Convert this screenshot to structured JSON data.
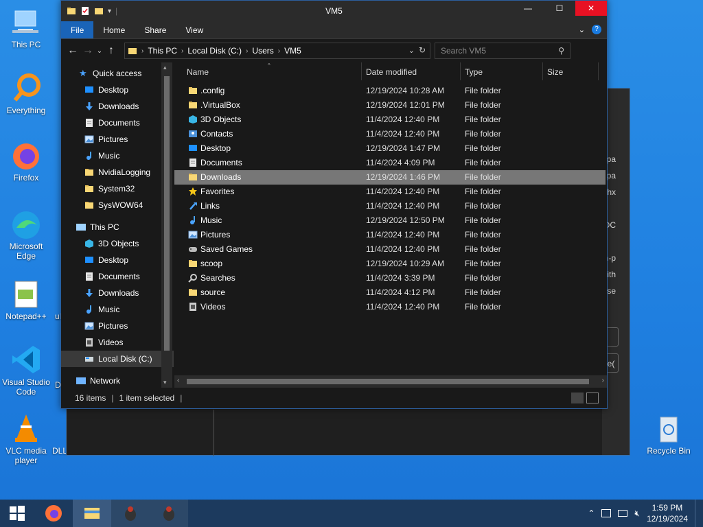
{
  "desktop": {
    "icons": [
      {
        "label": "This PC",
        "name": "this-pc-icon"
      },
      {
        "label": "Everything",
        "name": "everything-icon"
      },
      {
        "label": "Firefox",
        "name": "firefox-icon"
      },
      {
        "label": "Microsoft Edge",
        "name": "edge-icon"
      },
      {
        "label": "Notepad++",
        "name": "notepadpp-icon"
      },
      {
        "label": "Visual Studio Code",
        "name": "vscode-icon"
      },
      {
        "label": "VLC media player",
        "name": "vlc-icon"
      },
      {
        "label": "DLLLoader.com",
        "name": "dll-icon"
      },
      {
        "label": "Recycle Bin",
        "name": "recycle-bin-icon"
      }
    ],
    "partial_labels": {
      "udd": "uD",
      "dll": "DL",
      "ud_left": "u"
    }
  },
  "background_window": {
    "snippets": [
      "epa",
      "epa",
      "hx",
      "OC",
      "n-p",
      "gith",
      "ase",
      "_e("
    ]
  },
  "window": {
    "title": "VM5",
    "ribbon_tabs": [
      "File",
      "Home",
      "Share",
      "View"
    ],
    "path": [
      "This PC",
      "Local Disk (C:)",
      "Users",
      "VM5"
    ],
    "search_placeholder": "Search VM5",
    "columns": {
      "name": "Name",
      "date": "Date modified",
      "type": "Type",
      "size": "Size"
    },
    "nav": {
      "quick_access": "Quick access",
      "quick_items": [
        {
          "label": "Desktop",
          "pinned": true,
          "icon": "desktop-icon"
        },
        {
          "label": "Downloads",
          "pinned": true,
          "icon": "download-icon"
        },
        {
          "label": "Documents",
          "pinned": true,
          "icon": "documents-icon"
        },
        {
          "label": "Pictures",
          "pinned": true,
          "icon": "pictures-icon"
        },
        {
          "label": "Music",
          "pinned": false,
          "icon": "music-icon"
        },
        {
          "label": "NvidiaLogging",
          "pinned": false,
          "icon": "folder-icon"
        },
        {
          "label": "System32",
          "pinned": false,
          "icon": "folder-icon"
        },
        {
          "label": "SysWOW64",
          "pinned": false,
          "icon": "folder-icon"
        }
      ],
      "this_pc": "This PC",
      "pc_items": [
        {
          "label": "3D Objects",
          "icon": "3d-objects-icon"
        },
        {
          "label": "Desktop",
          "icon": "desktop-icon"
        },
        {
          "label": "Documents",
          "icon": "documents-icon"
        },
        {
          "label": "Downloads",
          "icon": "download-icon"
        },
        {
          "label": "Music",
          "icon": "music-icon"
        },
        {
          "label": "Pictures",
          "icon": "pictures-icon"
        },
        {
          "label": "Videos",
          "icon": "videos-icon"
        },
        {
          "label": "Local Disk (C:)",
          "icon": "drive-icon"
        }
      ],
      "network": "Network"
    },
    "files": [
      {
        "name": ".config",
        "date": "12/19/2024 10:28 AM",
        "type": "File folder",
        "icon": "folder"
      },
      {
        "name": ".VirtualBox",
        "date": "12/19/2024 12:01 PM",
        "type": "File folder",
        "icon": "folder"
      },
      {
        "name": "3D Objects",
        "date": "11/4/2024 12:40 PM",
        "type": "File folder",
        "icon": "3d"
      },
      {
        "name": "Contacts",
        "date": "11/4/2024 12:40 PM",
        "type": "File folder",
        "icon": "contacts"
      },
      {
        "name": "Desktop",
        "date": "12/19/2024 1:47 PM",
        "type": "File folder",
        "icon": "desktop"
      },
      {
        "name": "Documents",
        "date": "11/4/2024 4:09 PM",
        "type": "File folder",
        "icon": "documents"
      },
      {
        "name": "Downloads",
        "date": "12/19/2024 1:46 PM",
        "type": "File folder",
        "icon": "folder",
        "selected": true
      },
      {
        "name": "Favorites",
        "date": "11/4/2024 12:40 PM",
        "type": "File folder",
        "icon": "star"
      },
      {
        "name": "Links",
        "date": "11/4/2024 12:40 PM",
        "type": "File folder",
        "icon": "links"
      },
      {
        "name": "Music",
        "date": "12/19/2024 12:50 PM",
        "type": "File folder",
        "icon": "music"
      },
      {
        "name": "Pictures",
        "date": "11/4/2024 12:40 PM",
        "type": "File folder",
        "icon": "pictures"
      },
      {
        "name": "Saved Games",
        "date": "11/4/2024 12:40 PM",
        "type": "File folder",
        "icon": "games"
      },
      {
        "name": "scoop",
        "date": "12/19/2024 10:29 AM",
        "type": "File folder",
        "icon": "folder"
      },
      {
        "name": "Searches",
        "date": "11/4/2024 3:39 PM",
        "type": "File folder",
        "icon": "search"
      },
      {
        "name": "source",
        "date": "11/4/2024 4:12 PM",
        "type": "File folder",
        "icon": "folder"
      },
      {
        "name": "Videos",
        "date": "11/4/2024 12:40 PM",
        "type": "File folder",
        "icon": "videos"
      }
    ],
    "status": {
      "count": "16 items",
      "selected": "1 item selected"
    }
  },
  "taskbar": {
    "time": "1:59 PM",
    "date": "12/19/2024"
  },
  "colors": {
    "accent": "#1a64b8",
    "close": "#e81123",
    "folder": "#f8d775",
    "desktop": "#1f7fe0"
  }
}
